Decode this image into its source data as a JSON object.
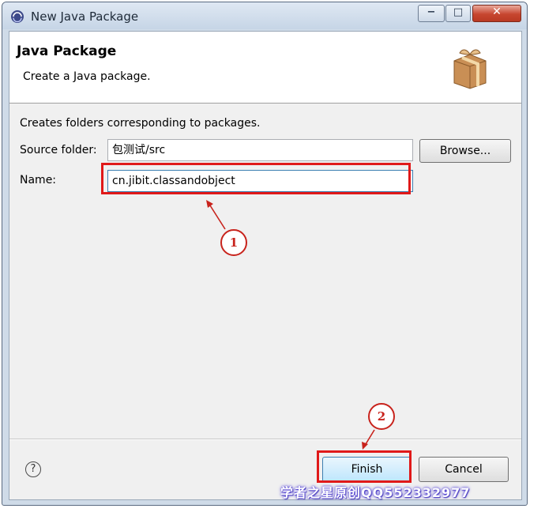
{
  "window": {
    "title": "New Java Package",
    "controls": {
      "minimize": "−",
      "maximize": "□",
      "close": "✕"
    }
  },
  "banner": {
    "title": "Java Package",
    "description": "Create a Java package.",
    "icon": "package-icon"
  },
  "form": {
    "intro": "Creates folders corresponding to packages.",
    "source_folder": {
      "label": "Source folder:",
      "value": "包测试/src",
      "browse_label": "Browse..."
    },
    "name": {
      "label": "Name:",
      "value": "cn.jibit.classandobject"
    }
  },
  "footer": {
    "help": "?",
    "finish_label": "Finish",
    "cancel_label": "Cancel"
  },
  "annotations": {
    "marker1": "1",
    "marker2": "2",
    "highlight_color": "#e01919"
  },
  "watermark": "学者之星原创QQ552332977"
}
